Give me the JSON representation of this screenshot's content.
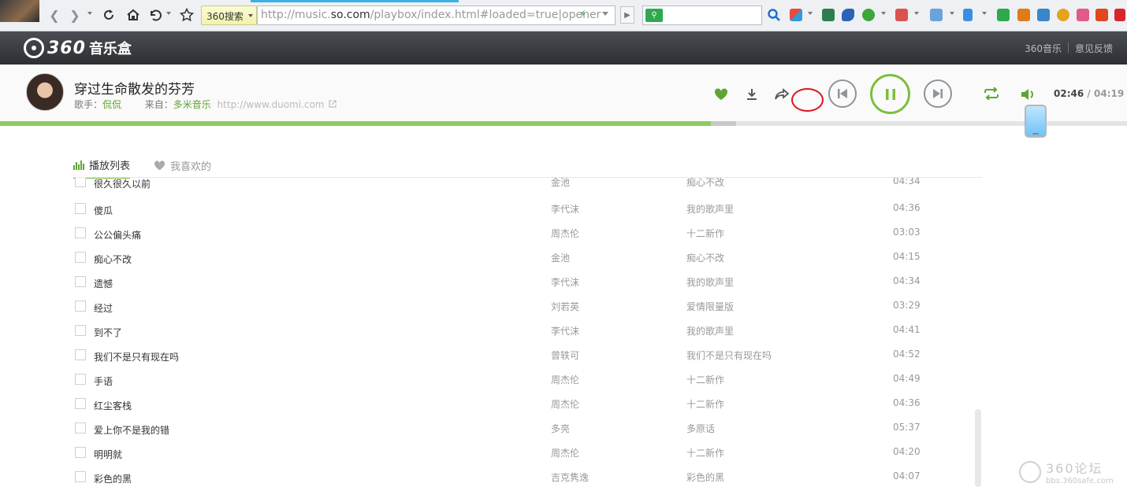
{
  "browser": {
    "search_engine": "360搜索",
    "url_prefix": "http://music.",
    "url_domain": "so.com",
    "url_suffix": "/playbox/index.html#loaded=true|opener"
  },
  "header": {
    "logo_number": "360",
    "logo_text": "音乐盒",
    "links": [
      "360音乐",
      "意见反馈"
    ]
  },
  "player": {
    "title": "穿过生命散发的芬芳",
    "singer_label": "歌手：",
    "singer": "侃侃",
    "source_label": "来自：",
    "source": "多米音乐",
    "source_url": "http://www.duomi.com",
    "current_time": "02:46",
    "separator": "/",
    "total_time": "04:19",
    "progress": 0.631,
    "buffered_start": 0.631,
    "buffered_end": 0.653
  },
  "tabs": [
    {
      "label": "播放列表",
      "active": true
    },
    {
      "label": "我喜欢的",
      "active": false
    }
  ],
  "songs": [
    {
      "name": "很久很久以前",
      "artist": "金池",
      "album": "痴心不改",
      "duration": "04:34"
    },
    {
      "name": "傻瓜",
      "artist": "李代沫",
      "album": "我的歌声里",
      "duration": "04:36"
    },
    {
      "name": "公公偏头痛",
      "artist": "周杰伦",
      "album": "十二新作",
      "duration": "03:03"
    },
    {
      "name": "痴心不改",
      "artist": "金池",
      "album": "痴心不改",
      "duration": "04:15"
    },
    {
      "name": "遗憾",
      "artist": "李代沫",
      "album": "我的歌声里",
      "duration": "04:34"
    },
    {
      "name": "经过",
      "artist": "刘若英",
      "album": "爱情限量版",
      "duration": "03:29"
    },
    {
      "name": "到不了",
      "artist": "李代沫",
      "album": "我的歌声里",
      "duration": "04:41"
    },
    {
      "name": "我们不是只有现在吗",
      "artist": "曾轶可",
      "album": "我们不是只有现在吗",
      "duration": "04:52"
    },
    {
      "name": "手语",
      "artist": "周杰伦",
      "album": "十二新作",
      "duration": "04:49"
    },
    {
      "name": "红尘客栈",
      "artist": "周杰伦",
      "album": "十二新作",
      "duration": "04:36"
    },
    {
      "name": "爱上你不是我的错",
      "artist": "多亮",
      "album": "多原话",
      "duration": "05:37"
    },
    {
      "name": "明明就",
      "artist": "周杰伦",
      "album": "十二新作",
      "duration": "04:20"
    },
    {
      "name": "彩色的黑",
      "artist": "吉克隽逸",
      "album": "彩色的黑",
      "duration": "04:07"
    }
  ],
  "watermark": {
    "title": "360论坛",
    "url": "bbs.360safe.com"
  },
  "colors": {
    "accent_green": "#7bbf3e",
    "highlight_red": "#e0141b"
  }
}
